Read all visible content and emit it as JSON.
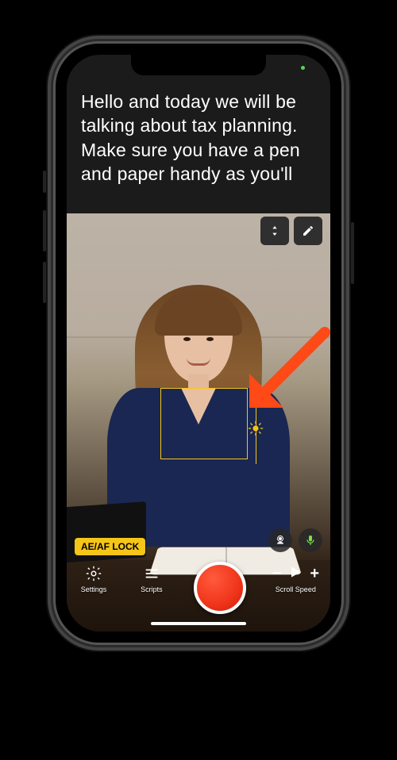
{
  "prompter": {
    "text": "Hello and today we will be talking about tax planning. Make sure you have a pen and paper handy as you'll"
  },
  "prompter_controls": {
    "resize_icon": "scroll-resize-icon",
    "edit_icon": "edit-icon"
  },
  "focus": {
    "badge": "AE/AF LOCK"
  },
  "toolbar": {
    "settings_label": "Settings",
    "scripts_label": "Scripts",
    "scroll_speed_label": "Scroll Speed",
    "minus": "−",
    "plus": "+"
  },
  "icons": {
    "sun": "exposure-sun-icon",
    "switch_camera": "switch-camera-icon",
    "mic": "microphone-icon",
    "settings": "gear-icon",
    "scripts": "menu-icon",
    "play": "play-icon"
  },
  "annotation_arrow": "arrow pointing to exposure sun"
}
